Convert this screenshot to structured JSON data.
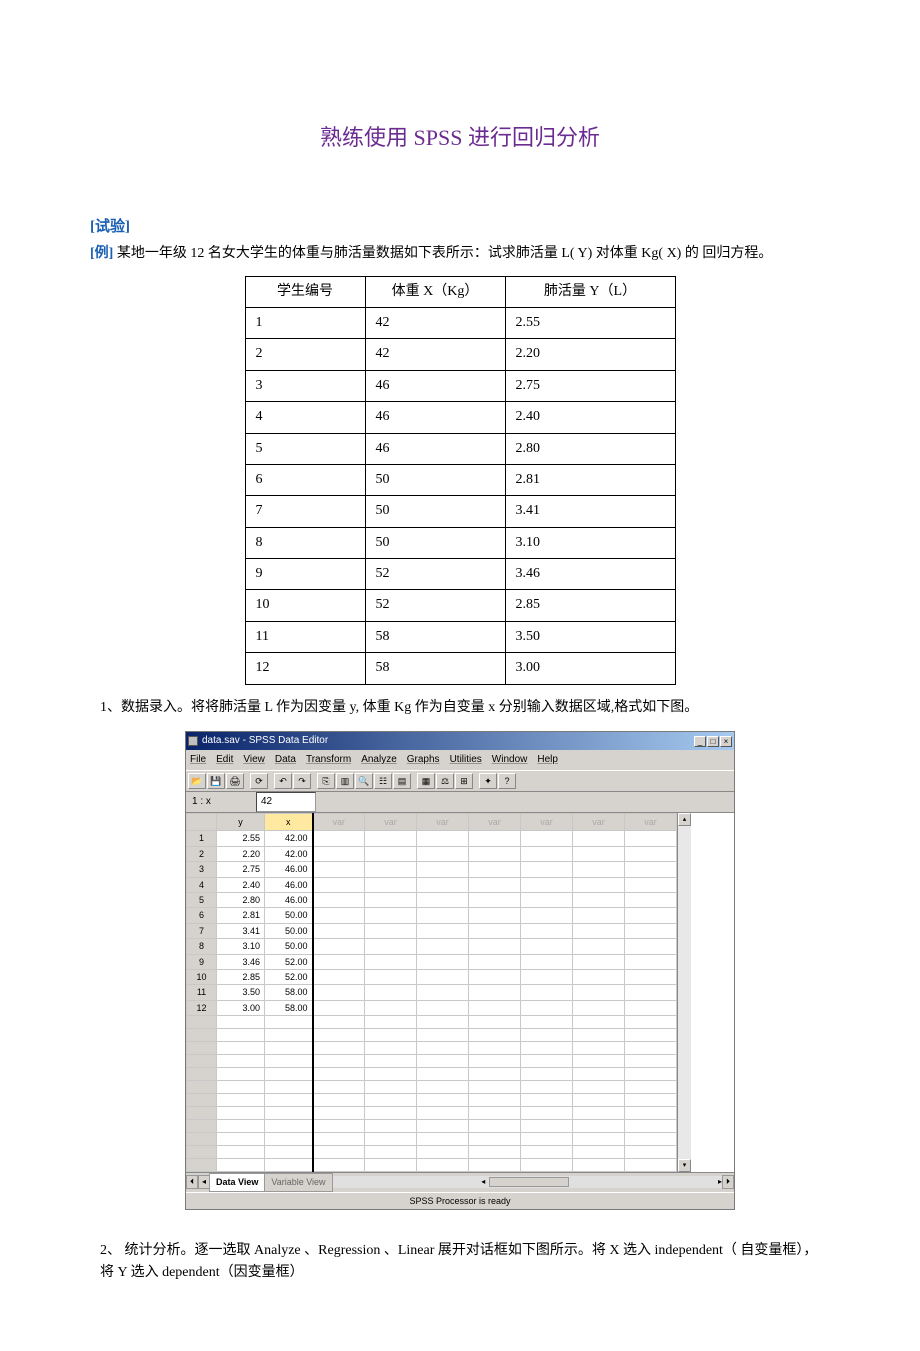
{
  "title": "熟练使用 SPSS 进行回归分析",
  "section_heading": "[试验]",
  "example_label": "[例]",
  "example_text": " 某地一年级 12 名女大学生的体重与肺活量数据如下表所示：试求肺活量 L( Y)  对体重 Kg( X)  的   回归方程。",
  "table": {
    "headers": [
      "学生编号",
      "体重 X（Kg）",
      "肺活量 Y（L）"
    ],
    "rows": [
      [
        "1",
        "42",
        "2.55"
      ],
      [
        "2",
        "42",
        "2.20"
      ],
      [
        "3",
        "46",
        "2.75"
      ],
      [
        "4",
        "46",
        "2.40"
      ],
      [
        "5",
        "46",
        "2.80"
      ],
      [
        "6",
        "50",
        "2.81"
      ],
      [
        "7",
        "50",
        "3.41"
      ],
      [
        "8",
        "50",
        "3.10"
      ],
      [
        "9",
        "52",
        "3.46"
      ],
      [
        "10",
        "52",
        "2.85"
      ],
      [
        "11",
        "58",
        "3.50"
      ],
      [
        "12",
        "58",
        "3.00"
      ]
    ]
  },
  "para1": "1、数据录入。将将肺活量 L 作为因变量 y,  体重 Kg 作为自变量 x 分别输入数据区域,格式如下图。",
  "para2": "2、  统计分析。逐一选取 Analyze 、Regression 、Linear  展开对话框如下图所示。将 X  选入 independent（ 自变量框），将 Y 选入 dependent（因变量框）",
  "spss": {
    "title": "data.sav - SPSS Data Editor",
    "menu": [
      "File",
      "Edit",
      "View",
      "Data",
      "Transform",
      "Analyze",
      "Graphs",
      "Utilities",
      "Window",
      "Help"
    ],
    "cell_label": "1 : x",
    "cell_value": "42",
    "cols": [
      "",
      "y",
      "x",
      "var",
      "var",
      "var",
      "var",
      "var",
      "var",
      "var"
    ],
    "rows": [
      [
        "1",
        "2.55",
        "42.00"
      ],
      [
        "2",
        "2.20",
        "42.00"
      ],
      [
        "3",
        "2.75",
        "46.00"
      ],
      [
        "4",
        "2.40",
        "46.00"
      ],
      [
        "5",
        "2.80",
        "46.00"
      ],
      [
        "6",
        "2.81",
        "50.00"
      ],
      [
        "7",
        "3.41",
        "50.00"
      ],
      [
        "8",
        "3.10",
        "50.00"
      ],
      [
        "9",
        "3.46",
        "52.00"
      ],
      [
        "10",
        "2.85",
        "52.00"
      ],
      [
        "11",
        "3.50",
        "58.00"
      ],
      [
        "12",
        "3.00",
        "58.00"
      ]
    ],
    "empty_rows": 12,
    "tabs": {
      "active": "Data View",
      "inactive": "Variable View"
    },
    "status": "SPSS Processor   is ready"
  }
}
